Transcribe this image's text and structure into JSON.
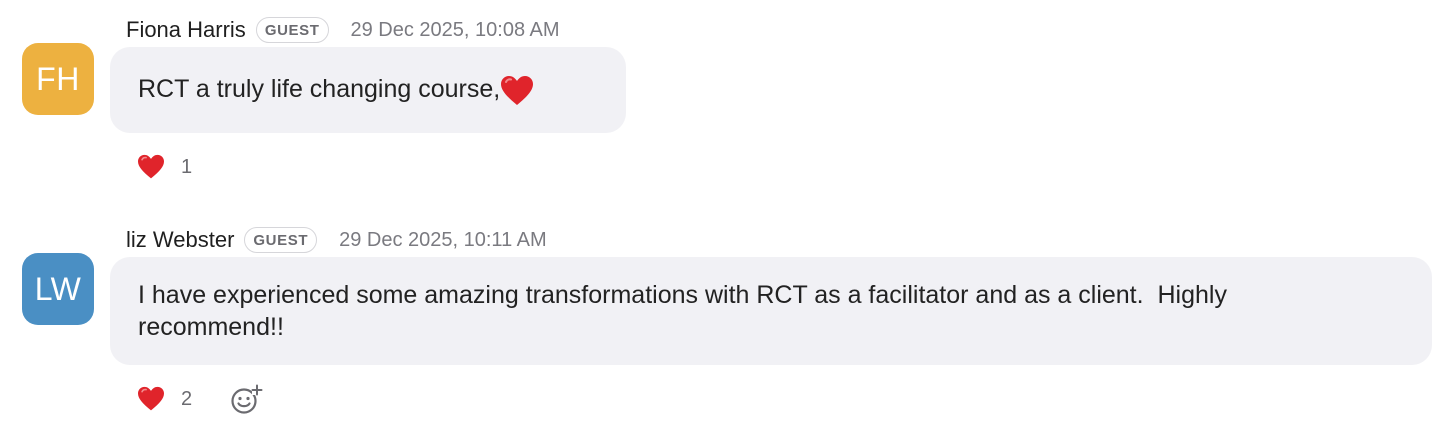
{
  "messages": [
    {
      "initials": "FH",
      "avatar_color": "#EDB140",
      "name": "Fiona Harris",
      "badge": "GUEST",
      "timestamp": "29 Dec 2025, 10:08 AM",
      "text": "RCT a truly life changing course,",
      "text_emoji": "heart-emoji",
      "reaction_icon": "heart-emoji",
      "reaction_count": "1"
    },
    {
      "initials": "LW",
      "avatar_color": "#4A8FC4",
      "name": "liz Webster",
      "badge": "GUEST",
      "timestamp": "29 Dec 2025, 10:11 AM",
      "text_line1": "I have experienced some amazing transformations with RCT as a facilitator and as a client.  Highly",
      "text_line2": "recommend!!",
      "reaction_icon": "heart-emoji",
      "reaction_count": "2",
      "add_reaction_icon": "add-reaction-icon"
    }
  ]
}
